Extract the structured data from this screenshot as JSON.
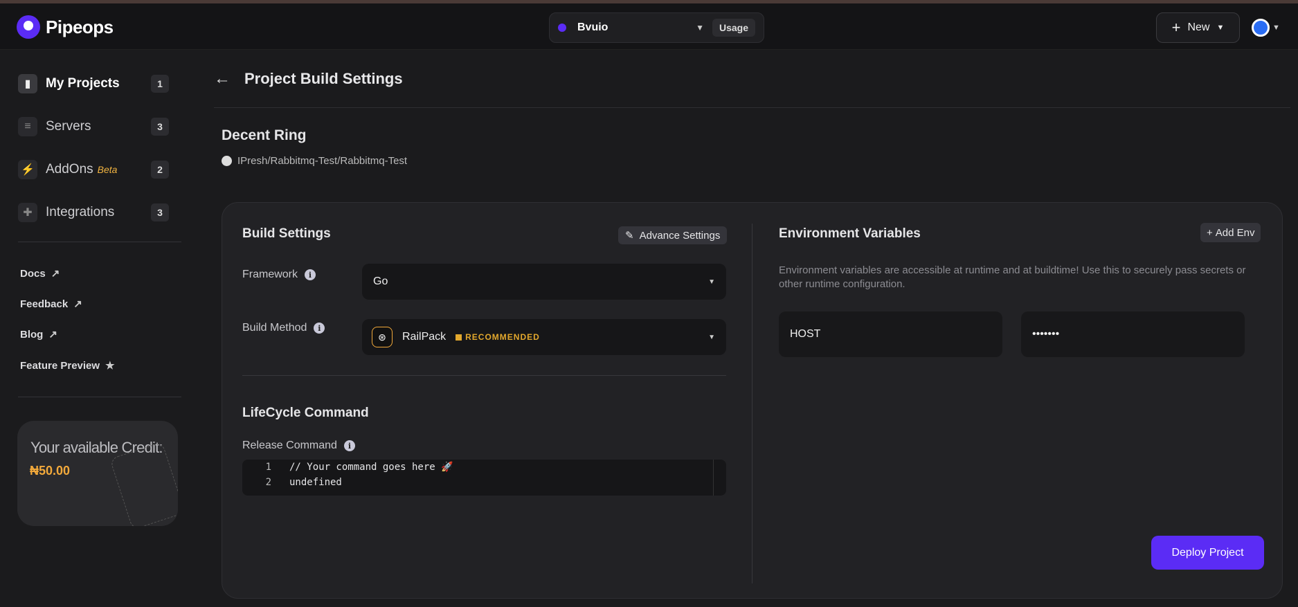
{
  "brand": {
    "name": "Pipeops"
  },
  "workspace": {
    "name": "Bvuio",
    "usage_label": "Usage"
  },
  "header": {
    "new_label": "New"
  },
  "sidebar": {
    "items": [
      {
        "label": "My Projects",
        "count": "1",
        "icon": "file-icon"
      },
      {
        "label": "Servers",
        "count": "3",
        "icon": "server-icon"
      },
      {
        "label": "AddOns",
        "badge": "Beta",
        "count": "2",
        "icon": "plug-icon"
      },
      {
        "label": "Integrations",
        "count": "3",
        "icon": "puzzle-icon"
      }
    ],
    "links": [
      {
        "label": "Docs"
      },
      {
        "label": "Feedback"
      },
      {
        "label": "Blog"
      },
      {
        "label": "Feature Preview"
      }
    ],
    "credit": {
      "title": "Your available Credit:",
      "value": "₦50.00"
    }
  },
  "page": {
    "title": "Project Build Settings"
  },
  "project": {
    "name": "Decent Ring",
    "repo": "IPresh/Rabbitmq-Test/Rabbitmq-Test"
  },
  "build": {
    "title": "Build Settings",
    "advance_label": "Advance Settings",
    "framework_label": "Framework",
    "framework_value": "Go",
    "method_label": "Build Method",
    "method_value": "RailPack",
    "method_badge": "RECOMMENDED"
  },
  "lifecycle": {
    "title": "LifeCycle Command",
    "release_label": "Release Command",
    "lines": [
      {
        "num": "1",
        "text": "// Your command goes here 🚀"
      },
      {
        "num": "2",
        "text": "undefined"
      }
    ]
  },
  "env": {
    "title": "Environment Variables",
    "add_label": "Add Env",
    "description": "Environment variables are accessible at runtime and at buildtime! Use this to securely pass secrets or other runtime configuration.",
    "key": "HOST",
    "value": "•••••••"
  },
  "deploy_label": "Deploy Project",
  "colors": {
    "accent": "#5b2cf5",
    "credit": "#f2a93b",
    "recommended": "#e3a82d"
  }
}
